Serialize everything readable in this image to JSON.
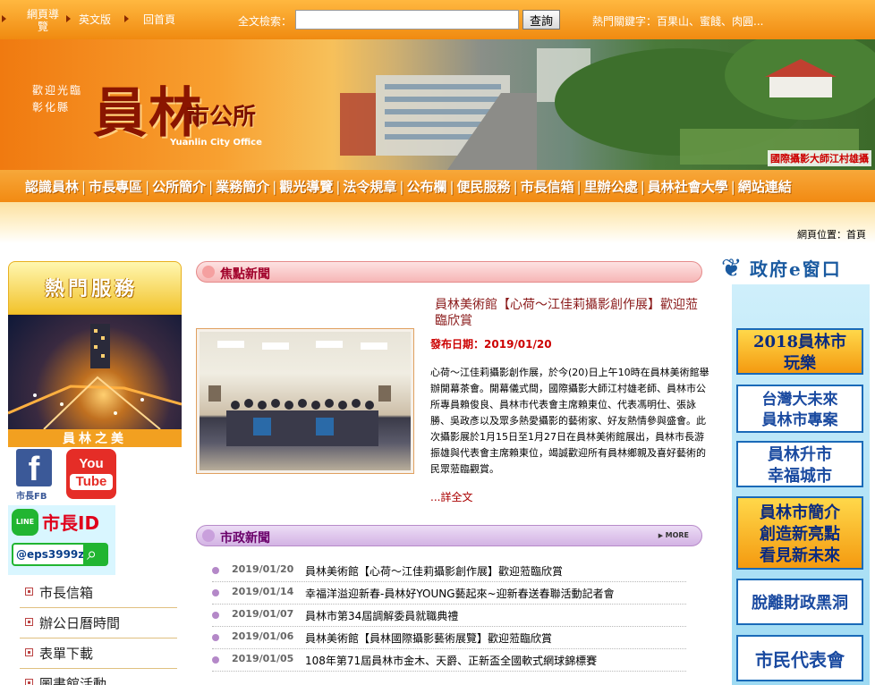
{
  "topbar": {
    "sitemap": "網頁導覽",
    "english": "英文版",
    "home": "回首頁",
    "search_label": "全文檢索：",
    "search_button": "查詢",
    "hot_keywords": "熱門關鍵字：百果山、蜜餞、肉圓..."
  },
  "banner": {
    "greeting_line1": "歡迎光臨",
    "greeting_line2": "彰化縣",
    "city_name": "員林",
    "office": "市公所",
    "english_name": "Yuanlin City Office",
    "photo_credit": "國際攝影大師江村雄攝"
  },
  "nav": {
    "items": [
      "認識員林",
      "市長專區",
      "公所簡介",
      "業務簡介",
      "觀光導覽",
      "法令規章",
      "公布欄",
      "便民服務",
      "市長信箱",
      "里辦公處",
      "員林社會大學",
      "網站連結"
    ]
  },
  "breadcrumb": "網頁位置：首頁",
  "left": {
    "hot_services_title": "熱門服務",
    "beauty_label": "員林之美",
    "fb_label": "市長FB",
    "youtube_line1": "You",
    "youtube_line2": "Tube",
    "line_title": "市長ID",
    "line_id": "@eps3999z",
    "links": [
      "市長信箱",
      "辦公日曆時間",
      "表單下載",
      "圖書館活動"
    ]
  },
  "focus": {
    "title": "焦點新聞",
    "article_title": "員林美術館【心荷～江佳莉攝影創作展】歡迎蒞臨欣賞",
    "date_label": "發布日期：",
    "date": "2019/01/20",
    "body": "心荷～江佳莉攝影創作展，於今(20)日上午10時在員林美術館舉辦開幕茶會。開幕儀式間，國際攝影大師江村雄老師、員林市公所專員賴俊良、員林市代表會主席賴東位、代表馮明仕、張詠勝、吳政彥以及眾多熱愛攝影的藝術家、好友熱情參與盛會。此次攝影展於1月15日至1月27日在員林美術館展出，員林市長游振雄與代表會主席賴東位，竭誠歡迎所有員林鄉親及喜好藝術的民眾蒞臨觀賞。",
    "read_more": "...詳全文"
  },
  "gov_news": {
    "title": "市政新聞",
    "more": "MORE",
    "items": [
      {
        "date": "2019/01/20",
        "title": "員林美術館【心荷～江佳莉攝影創作展】歡迎蒞臨欣賞"
      },
      {
        "date": "2019/01/14",
        "title": "幸福洋溢迎新春-員林好YOUNG藝起來~迎新春送春聯活動記者會"
      },
      {
        "date": "2019/01/07",
        "title": "員林市第34屆調解委員就職典禮"
      },
      {
        "date": "2019/01/06",
        "title": "員林美術館【員林國際攝影藝術展覽】歡迎蒞臨欣賞"
      },
      {
        "date": "2019/01/05",
        "title": "108年第71屆員林市金木、天爵、正新盃全國軟式網球錦標賽"
      }
    ]
  },
  "egov": {
    "title": "政府e窗口",
    "boxes": [
      {
        "line1": "2018員林市",
        "line2": "玩樂"
      },
      {
        "line1": "台灣大未來",
        "line2": "員林市專案"
      },
      {
        "line1": "員林升市",
        "line2": "幸福城市"
      },
      {
        "line1": "員林市簡介",
        "line2": "創造新亮點",
        "line3": "看見新未來"
      },
      {
        "line1": "脫離財政黑洞"
      },
      {
        "line1": "市民代表會"
      }
    ]
  }
}
